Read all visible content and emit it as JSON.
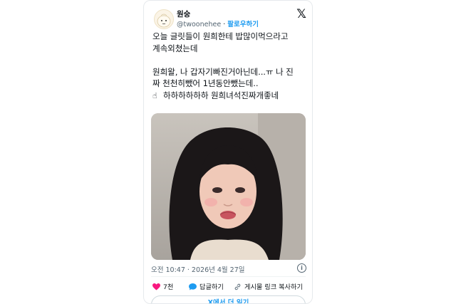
{
  "tweet": {
    "author_name": "원숭",
    "handle": "@twoonehee",
    "follow_label": "팔로우하기",
    "x_logo": "𝕏",
    "text_main": "오늘 글릿들이 원희한테 밥많이먹으라고\n계속외쳤는데\n\n원희왈, 나 갑자기빠진거아닌데...ㅠ 나 진\n짜 천천히뺐어 1년동안뺐는데..\n",
    "text_last_emoji": "☝",
    "text_last": "하하하하하하 원희녀석진짜개좋네",
    "timestamp": "오전 10:47 · 2026년 4월 27일",
    "info_icon": "i"
  },
  "actions": {
    "like_count": "7천",
    "reply_label": "답글하기",
    "copy_label": "게시물 링크 복사하기"
  },
  "read_more_label": "X에서 더 읽기",
  "colors": {
    "accent": "#1d9bf0",
    "like": "#f91880",
    "text": "#0f1419",
    "muted": "#536471"
  }
}
